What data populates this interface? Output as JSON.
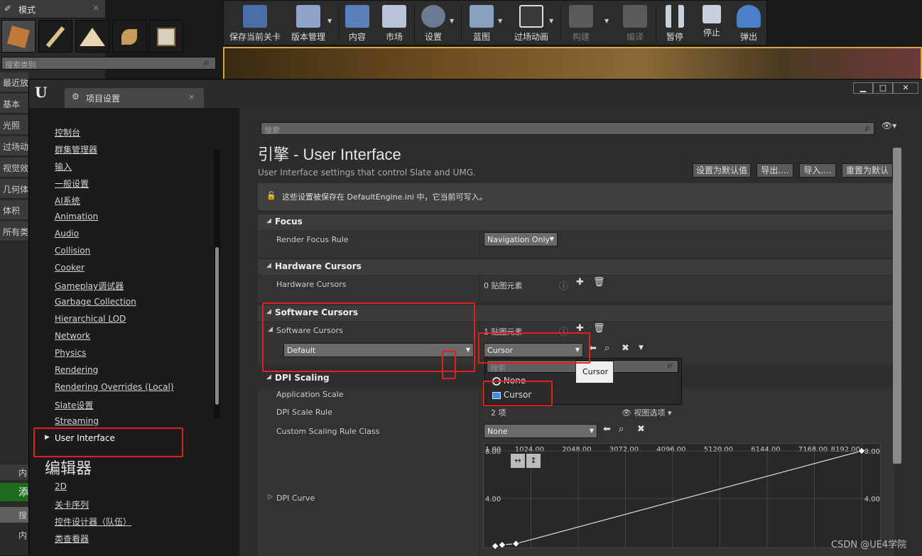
{
  "modes_panel": {
    "tab_title": "模式",
    "search_placeholder": "搜索类别",
    "categories": [
      "最近放",
      "基本",
      "光照",
      "过场动",
      "视觉效",
      "几何体",
      "体积",
      "所有类"
    ]
  },
  "toolbar": {
    "buttons": [
      {
        "label": "保存当前关卡",
        "icon": "save-icon"
      },
      {
        "label": "版本管理",
        "icon": "source-control-icon"
      },
      {
        "label": "内容",
        "icon": "content-icon"
      },
      {
        "label": "市场",
        "icon": "marketplace-icon"
      },
      {
        "label": "设置",
        "icon": "settings-icon"
      },
      {
        "label": "蓝图",
        "icon": "blueprint-icon"
      },
      {
        "label": "过场动画",
        "icon": "cinematics-icon"
      },
      {
        "label": "构建",
        "icon": "build-icon"
      },
      {
        "label": "编译",
        "icon": "compile-icon"
      },
      {
        "label": "暂停",
        "icon": "pause-icon"
      },
      {
        "label": "停止",
        "icon": "stop-icon"
      },
      {
        "label": "弹出",
        "icon": "eject-icon"
      }
    ]
  },
  "window": {
    "tab_title": "项目设置",
    "nav_items": [
      "控制台",
      "群集管理器",
      "输入",
      "一般设置",
      "AI系统",
      "Animation",
      "Audio",
      "Collision",
      "Cooker",
      "Gameplay调试器",
      "Garbage Collection",
      "Hierarchical LOD",
      "Network",
      "Physics",
      "Rendering",
      "Rendering Overrides (Local)",
      "Slate设置",
      "Streaming",
      "User Interface"
    ],
    "editor_heading": "编辑器",
    "editor_items": [
      "2D",
      "关卡序列",
      "控件设计器（队伍）",
      "类查看器"
    ],
    "bottom_left_labels": [
      "内",
      "添",
      "搜",
      "内"
    ]
  },
  "main": {
    "search_placeholder": "搜索",
    "title": "引擎 - User Interface",
    "description": "User Interface settings that control Slate and UMG.",
    "buttons": [
      "设置为默认值",
      "导出....",
      "导入....",
      "重置为默认"
    ],
    "notice": "这些设置被保存在 DefaultEngine.ini 中，它当前可写入。",
    "focus": {
      "header": "Focus",
      "render_focus_rule_label": "Render Focus Rule",
      "render_focus_rule_value": "Navigation Only"
    },
    "hardware": {
      "header": "Hardware Cursors",
      "label": "Hardware Cursors",
      "value": "0 贴图元素"
    },
    "software": {
      "header": "Software Cursors",
      "label": "Software Cursors",
      "value": "1 贴图元素",
      "key_value": "Default",
      "cursor_value": "Cursor"
    },
    "popup": {
      "search_placeholder": "搜索",
      "options": [
        "None",
        "Cursor"
      ],
      "tooltip": "Cursor"
    },
    "dpi": {
      "header": "DPI Scaling",
      "application_scale_label": "Application Scale",
      "dpi_scale_rule_label": "DPI Scale Rule",
      "dpi_scale_rule_value": "2 项",
      "view_options": "视图选项",
      "custom_scaling_label": "Custom Scaling Rule Class",
      "custom_scaling_value": "None",
      "dpi_curve_label": "DPI Curve"
    }
  },
  "chart_data": {
    "type": "line",
    "x_ticks": [
      "1.00",
      "1024.00",
      "2048.00",
      "3072.00",
      "4096.00",
      "5120.00",
      "6144.00",
      "7168.00",
      "8192.00"
    ],
    "y_ticks_left": [
      "8.00",
      "4.00"
    ],
    "y_ticks_right": [
      "8.00",
      "4.00"
    ],
    "points": [
      {
        "x": 250,
        "y": 0.0
      },
      {
        "x": 400,
        "y": 0.1
      },
      {
        "x": 700,
        "y": 0.2
      },
      {
        "x": 8192,
        "y": 8.0
      }
    ],
    "xlim": [
      1,
      8192
    ],
    "ylim": [
      0,
      8
    ]
  },
  "watermark": "CSDN @UE4学院"
}
